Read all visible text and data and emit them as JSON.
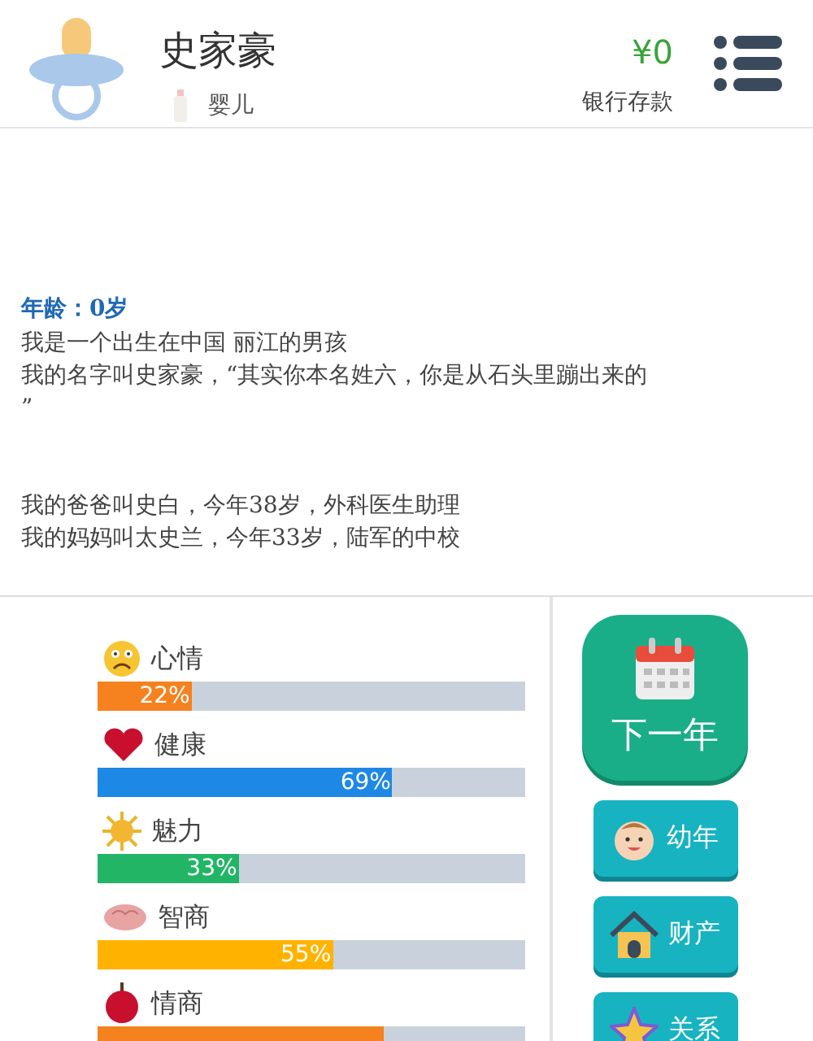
{
  "header": {
    "name": "史家豪",
    "stage": "婴儿",
    "money": "¥0",
    "money_label": "银行存款"
  },
  "story": {
    "age": "年龄：0岁",
    "paragraphs": [
      [
        "我是一个出生在中国 丽江的男孩",
        "我的名字叫史家豪，“其实你本名姓六，你是从石头里蹦出来的",
        "”"
      ],
      [
        "我的爸爸叫史白，今年38岁，外科医生助理",
        "我的妈妈叫太史兰，今年33岁，陆军的中校"
      ]
    ]
  },
  "stats": [
    {
      "kind": "mood",
      "label": "心情",
      "level": 0.22,
      "reading": "22%",
      "color": "#f5821f"
    },
    {
      "kind": "health",
      "label": "健康",
      "level": 0.69,
      "reading": "69%",
      "color": "#1e88e5"
    },
    {
      "kind": "charm",
      "label": "魅力",
      "level": 0.33,
      "reading": "33%",
      "color": "#22b566"
    },
    {
      "kind": "iq",
      "label": "智商",
      "level": 0.55,
      "reading": "55%",
      "color": "#ffb300"
    },
    {
      "kind": "eq",
      "label": "情商",
      "level": 0.67,
      "color": "#f5821f"
    }
  ],
  "next_button": {
    "label": "下一年"
  },
  "buttons": [
    {
      "kind": "baby",
      "label": "幼年"
    },
    {
      "kind": "house",
      "label": "财产"
    },
    {
      "kind": "star",
      "label": "关系"
    }
  ]
}
